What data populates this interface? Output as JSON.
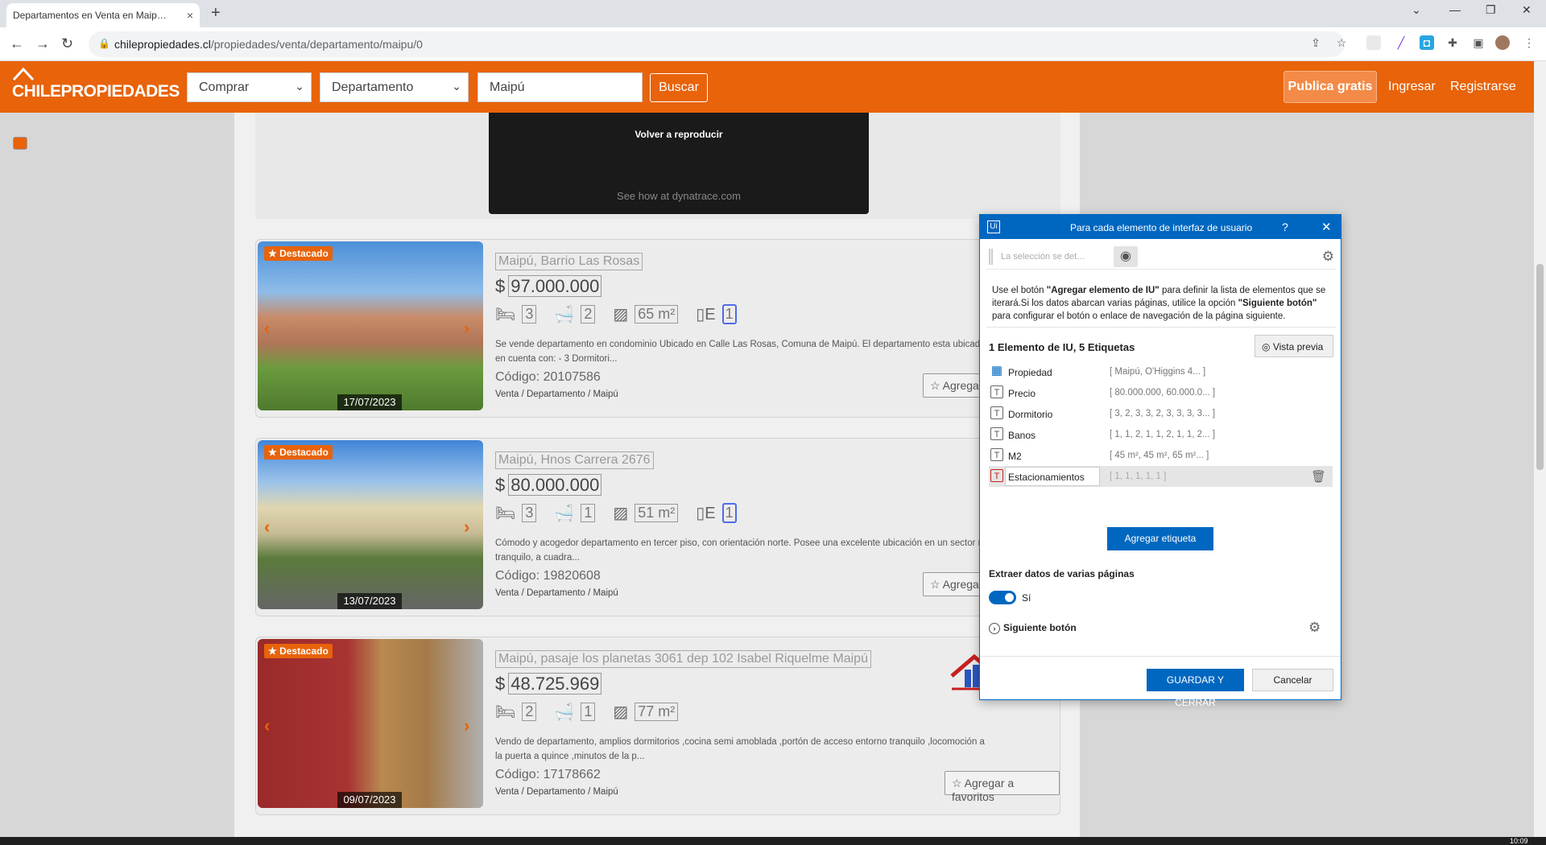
{
  "browser": {
    "tab_title": "Departamentos en Venta en Maip…",
    "tab_close": "×",
    "new_tab": "+",
    "url_host": "chilepropiedades.cl",
    "url_path": "/propiedades/venta/departamento/maipu/0"
  },
  "site": {
    "logo_a": "CHILE",
    "logo_b": "PROPIEDADES",
    "op_select": "Comprar",
    "type_select": "Departamento",
    "location_input": "Maipú",
    "search_button": "Buscar",
    "publish_button": "Publica gratis",
    "login": "Ingresar",
    "register": "Registrarse"
  },
  "video": {
    "replay": "Volver a reproducir",
    "see_how": "See how at dynatrace.com"
  },
  "listings": [
    {
      "badge": "★ Destacado",
      "date": "17/07/2023",
      "location": "Maipú, Barrio Las Rosas",
      "currency": "$",
      "price": "97.000.000",
      "bedrooms": "3",
      "bathrooms": "2",
      "area": "65 m²",
      "parking": "1",
      "description": "Se vende departamento en condominio Ubicado en Calle Las Rosas, Comuna de Maipú. El departamento esta ubicado en cuenta con: - 3 Dormitori...",
      "code_label": "Código:",
      "code": "20107586",
      "breadcrumb": "Venta / Departamento / Maipú",
      "fav": "☆ Agrega"
    },
    {
      "badge": "★ Destacado",
      "date": "13/07/2023",
      "location": "Maipú, Hnos Carrera 2676",
      "currency": "$",
      "price": "80.000.000",
      "bedrooms": "3",
      "bathrooms": "1",
      "area": "51 m²",
      "parking": "1",
      "description": "Cómodo y acogedor departamento en tercer piso, con orientación norte. Posee una excelente ubicación en un sector re tranquilo, a cuadra...",
      "code_label": "Código:",
      "code": "19820608",
      "breadcrumb": "Venta / Departamento / Maipú",
      "fav": "☆ Agrega"
    },
    {
      "badge": "★ Destacado",
      "date": "09/07/2023",
      "location": "Maipú, pasaje los planetas 3061 dep 102 Isabel Riquelme Maipú",
      "currency": "$",
      "price": "48.725.969",
      "bedrooms": "2",
      "bathrooms": "1",
      "area": "77 m²",
      "description": "Vendo de departamento, amplios dormitorios ,cocina semi amoblada ,portón de acceso entorno tranquilo ,locomoción a la puerta a quince ,minutos de la p...",
      "code_label": "Código:",
      "code": "17178662",
      "breadcrumb": "Venta / Departamento / Maipú",
      "fav": "☆ Agregar a favoritos"
    }
  ],
  "dialog": {
    "title": "Para cada elemento de interfaz de usuario",
    "help": "?",
    "close": "✕",
    "selector_placeholder": "La selección se det…",
    "instructions_a": "Use el botón ",
    "instructions_b": "\"Agregar elemento de IU\"",
    "instructions_c": " para definir la lista de elementos que se iterará.Si los datos abarcan varias páginas, utilice la opción ",
    "instructions_d": "\"Siguiente botón\"",
    "instructions_e": " para configurar el botón o enlace de navegación de la página siguiente.",
    "count": "1 Elemento de IU, 5 Etiquetas",
    "preview": "Vista previa",
    "labels": [
      {
        "name": "Propiedad",
        "value": "[ Maipú, O'Higgins 4...  ]"
      },
      {
        "name": "Precio",
        "value": "[ 80.000.000, 60.000.0... ]"
      },
      {
        "name": "Dormitorio",
        "value": "[ 3, 2, 3, 3, 2, 3, 3, 3, 3... ]"
      },
      {
        "name": "Banos",
        "value": "[ 1, 1, 2, 1, 1, 2, 1, 1, 2... ]"
      },
      {
        "name": "M2",
        "value": "[ 45 m², 45 m², 65 m²... ]"
      },
      {
        "name": "Estacionamientos",
        "value": "[ 1, 1, 1, 1, 1                ]"
      }
    ],
    "add_label": "Agregar etiqueta",
    "extract": "Extraer datos de varias páginas",
    "toggle_label": "Sí",
    "next_button": "Siguiente botón",
    "save": "GUARDAR Y CERRAR",
    "cancel": "Cancelar"
  },
  "taskbar": {
    "clock": "10:09"
  }
}
